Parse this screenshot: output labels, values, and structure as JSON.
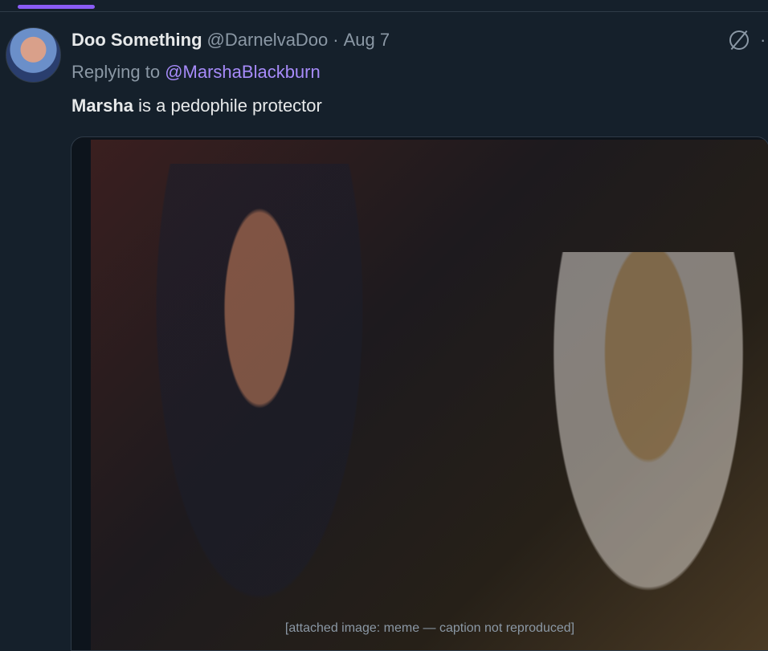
{
  "tweet": {
    "display_name": "Doo Something",
    "handle": "@DarnelvaDoo",
    "separator": "·",
    "timestamp": "Aug 7",
    "reply_prefix": "Replying to",
    "reply_to": "@MarshaBlackburn",
    "text_bold": "Marsha",
    "text_rest": " is a pedophile protector",
    "media_note": "[attached image: meme — caption not reproduced]"
  },
  "icons": {
    "grok": "grok-icon",
    "more": "more-icon"
  },
  "colors": {
    "background": "#15202b",
    "link": "#a78bfa",
    "muted": "#8b98a5",
    "tab_indicator": "#8a5cf6"
  }
}
